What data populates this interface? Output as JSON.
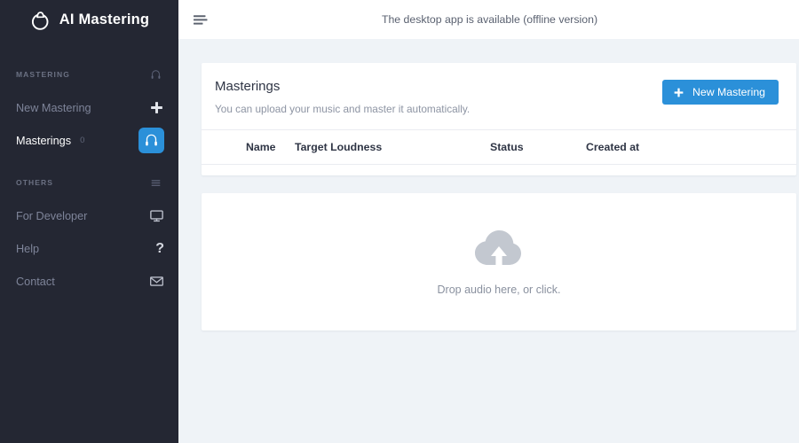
{
  "brand": {
    "name": "AI Mastering",
    "logo_icon": "headphone-ring-logo-icon"
  },
  "sidebar": {
    "sections": [
      {
        "label": "MASTERING",
        "icon": "headphone-icon",
        "items": [
          {
            "label": "New Mastering",
            "icon": "plus-icon",
            "active": false,
            "count": ""
          },
          {
            "label": "Masterings",
            "icon": "headphone-icon",
            "active": true,
            "count": "0"
          }
        ]
      },
      {
        "label": "OTHERS",
        "icon": "hamburger-icon",
        "items": [
          {
            "label": "For Developer",
            "icon": "monitor-icon",
            "active": false,
            "count": ""
          },
          {
            "label": "Help",
            "icon": "question-mark-icon",
            "active": false,
            "count": ""
          },
          {
            "label": "Contact",
            "icon": "envelope-icon",
            "active": false,
            "count": ""
          }
        ]
      }
    ]
  },
  "topbar": {
    "menu_icon": "menu-toggle-icon",
    "notice": "The desktop app is available (offline version)"
  },
  "masterings_card": {
    "title": "Masterings",
    "subtitle": "You can upload your music and master it automatically.",
    "new_button_label": "New Mastering",
    "new_button_icon": "plus-icon",
    "table": {
      "columns": [
        "Name",
        "Target Loudness",
        "Status",
        "Created at"
      ],
      "rows": []
    }
  },
  "dropzone": {
    "icon": "cloud-upload-icon",
    "text": "Drop audio here, or click."
  },
  "colors": {
    "sidebar_bg": "#242733",
    "accent": "#2b90d9",
    "page_bg": "#eff3f7",
    "card_bg": "#ffffff",
    "muted_text": "#8d94a3"
  }
}
